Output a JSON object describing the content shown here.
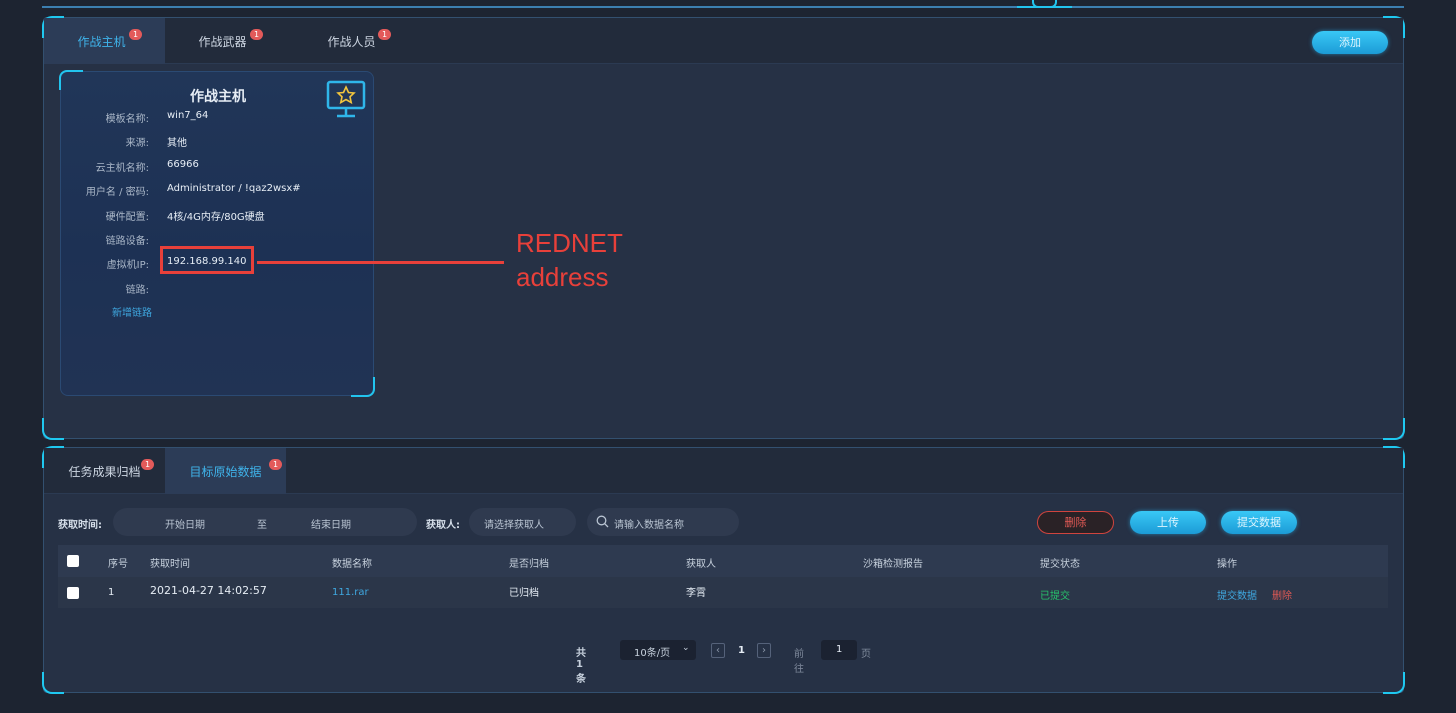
{
  "top_panel": {
    "tabs": [
      {
        "label": "作战主机",
        "badge": "1"
      },
      {
        "label": "作战武器",
        "badge": "1"
      },
      {
        "label": "作战人员",
        "badge": "1"
      }
    ],
    "add_button": "添加"
  },
  "host_card": {
    "title": "作战主机",
    "icon": "monitor-star-icon",
    "fields": [
      {
        "label": "模板名称:",
        "value": "win7_64"
      },
      {
        "label": "来源:",
        "value": "其他"
      },
      {
        "label": "云主机名称:",
        "value": "66966"
      },
      {
        "label": "用户名 / 密码:",
        "value": "Administrator / !qaz2wsx#"
      },
      {
        "label": "硬件配置:",
        "value": "4核/4G内存/80G硬盘"
      },
      {
        "label": "链路设备:",
        "value": ""
      },
      {
        "label": "虚拟机IP:",
        "value": "192.168.99.140"
      },
      {
        "label": "链路:",
        "value": ""
      }
    ],
    "add_link": "新增链路"
  },
  "annotation": {
    "line1": "REDNET",
    "line2": "address"
  },
  "bottom_panel": {
    "tabs": [
      {
        "label": "任务成果归档",
        "badge": "1"
      },
      {
        "label": "目标原始数据",
        "badge": "1"
      }
    ],
    "filters": {
      "time_label": "获取时间:",
      "start_placeholder": "开始日期",
      "to": "至",
      "end_placeholder": "结束日期",
      "person_label": "获取人:",
      "person_placeholder": "请选择获取人",
      "search_placeholder": "请输入数据名称"
    },
    "buttons": {
      "delete": "删除",
      "upload": "上传",
      "submit": "提交数据"
    },
    "table": {
      "headers": [
        "序号",
        "获取时间",
        "数据名称",
        "是否归档",
        "获取人",
        "沙箱检测报告",
        "提交状态",
        "操作"
      ],
      "rows": [
        {
          "index": "1",
          "time": "2021-04-27 14:02:57",
          "name": "111.rar",
          "archived": "已归档",
          "person": "李霄",
          "report": "",
          "status": "已提交",
          "action_submit": "提交数据",
          "action_delete": "删除"
        }
      ]
    },
    "pagination": {
      "total": "共 1 条",
      "page_size": "10条/页",
      "current_page": "1",
      "goto_label": "前往",
      "goto_value": "1",
      "page_suffix": "页"
    }
  },
  "colors": {
    "accent": "#1fc8f0",
    "danger": "#e8403a",
    "success": "#27c26c",
    "link": "#3fa8e0"
  }
}
